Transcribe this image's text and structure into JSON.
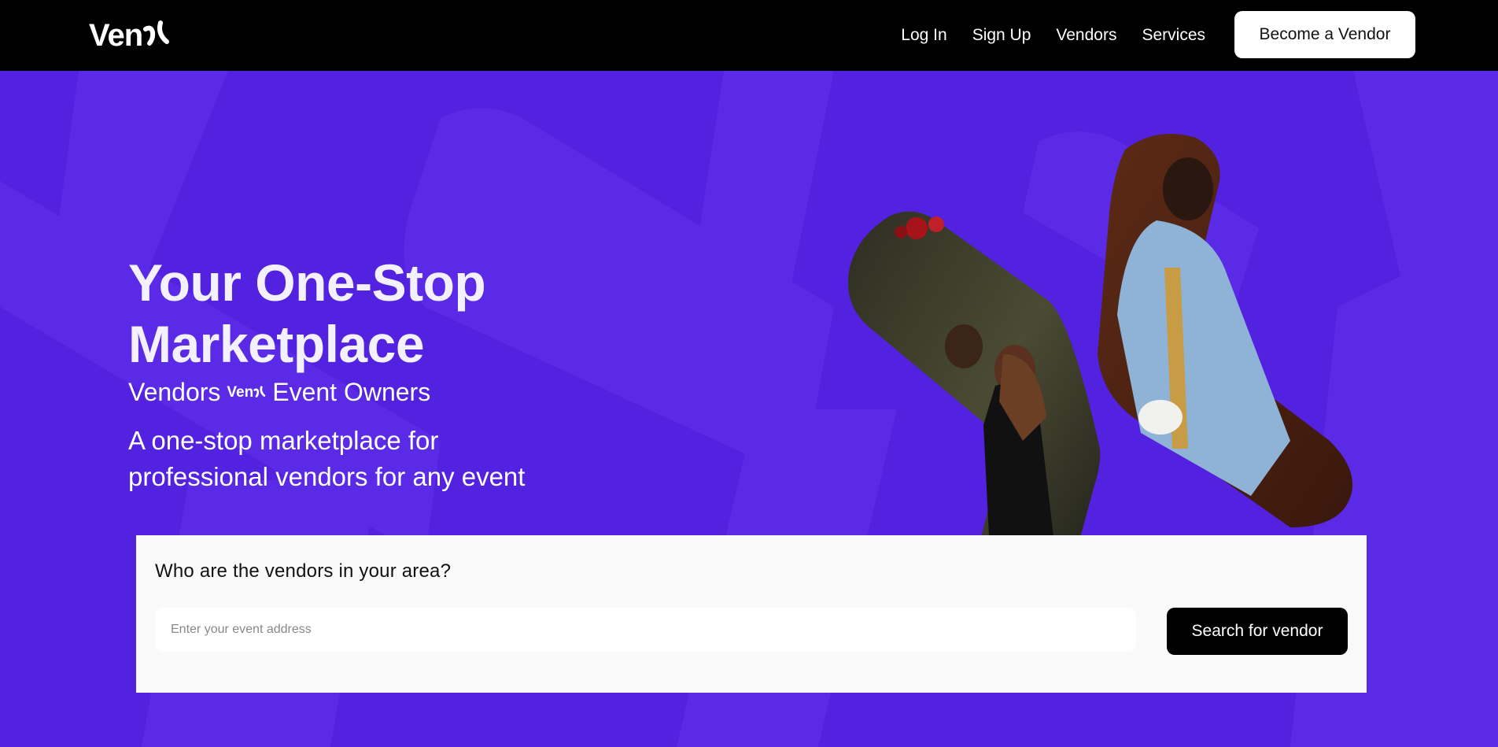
{
  "nav": {
    "logo_text": "Ven",
    "links": [
      {
        "label": "Log In"
      },
      {
        "label": "Sign Up"
      },
      {
        "label": "Vendors"
      },
      {
        "label": "Services"
      }
    ],
    "cta_label": "Become a Vendor"
  },
  "hero": {
    "title": "Your One-Stop Marketplace",
    "sub_left": "Vendors",
    "sub_logo": "Ven",
    "sub_right": "Event Owners",
    "description": "A one-stop marketplace for professional vendors for any event"
  },
  "search": {
    "question": "Who are the vendors in your area?",
    "placeholder": "Enter your event address",
    "button_label": "Search for vendor"
  },
  "colors": {
    "nav_bg": "#000000",
    "hero_bg": "#5321e0",
    "card_bg": "#f8f9f8",
    "button_dark": "#000000"
  },
  "icons": {
    "logo_mark": "venu-logo-mark",
    "hero_photo_left": "couple-photo",
    "hero_photo_right": "saxophonist-photo"
  }
}
